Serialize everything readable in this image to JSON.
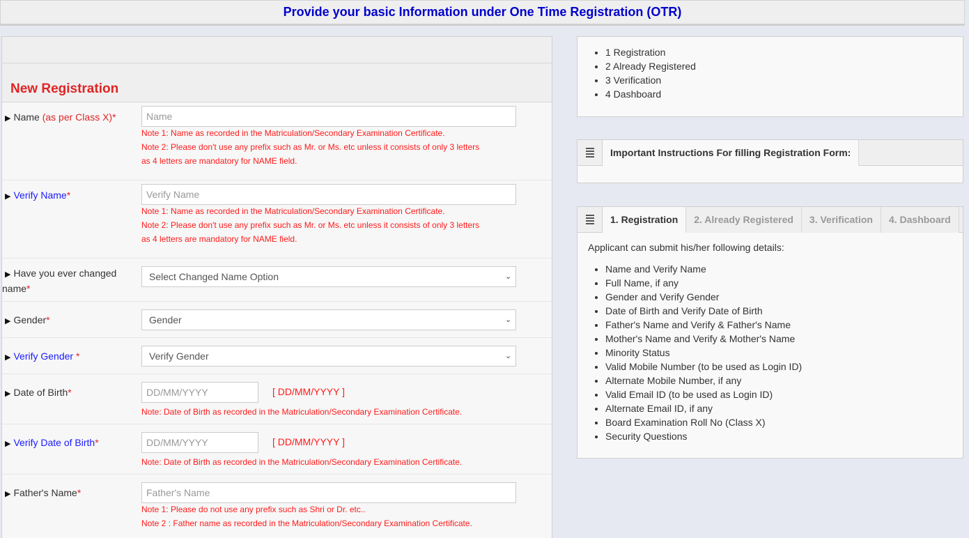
{
  "header": {
    "title": "Provide your basic Information under One Time Registration (OTR)"
  },
  "form": {
    "section_title": "New Registration",
    "fields": {
      "name": {
        "label": "Name",
        "label_suffix": "(as per Class X)",
        "required_mark": "*",
        "placeholder": "Name",
        "notes": [
          "Note 1: Name as recorded in the Matriculation/Secondary Examination Certificate.",
          "Note 2: Please don't use any prefix such as Mr. or Ms. etc unless it consists of only 3 letters",
          "as 4 letters are mandatory for NAME field."
        ]
      },
      "verify_name": {
        "label": "Verify Name",
        "required_mark": "*",
        "placeholder": "Verify Name",
        "notes": [
          "Note 1: Name as recorded in the Matriculation/Secondary Examination Certificate.",
          "Note 2: Please don't use any prefix such as Mr. or Ms. etc unless it consists of only 3 letters",
          "as 4 letters are mandatory for NAME field."
        ]
      },
      "changed_name": {
        "label_line1": "Have you ever changed",
        "label_line2": "name",
        "required_mark": "*",
        "selected": "Select Changed Name Option"
      },
      "gender": {
        "label": "Gender",
        "required_mark": "*",
        "selected": "Gender"
      },
      "verify_gender": {
        "label": "Verify Gender",
        "required_mark": " *",
        "selected": "Verify Gender"
      },
      "dob": {
        "label": "Date of Birth",
        "required_mark": "*",
        "placeholder": "DD/MM/YYYY",
        "format_hint": "[ DD/MM/YYYY ]",
        "note": "Note: Date of Birth as recorded in the Matriculation/Secondary Examination Certificate."
      },
      "verify_dob": {
        "label": "Verify Date of Birth",
        "required_mark": "*",
        "placeholder": "DD/MM/YYYY",
        "format_hint": "[ DD/MM/YYYY ]",
        "note": "Note: Date of Birth as recorded in the Matriculation/Secondary Examination Certificate."
      },
      "father_name": {
        "label": "Father's Name",
        "required_mark": "*",
        "placeholder": "Father's Name",
        "notes": [
          "Note 1: Please do not use any prefix such as Shri or Dr. etc..",
          "Note 2 : Father name as recorded in the Matriculation/Secondary Examination Certificate."
        ]
      }
    }
  },
  "steps": {
    "items": [
      "1 Registration",
      "2 Already Registered",
      "3 Verification",
      "4 Dashboard"
    ]
  },
  "instructions": {
    "tab_label": "Important Instructions For filling Registration Form:"
  },
  "info_panel": {
    "tabs": [
      {
        "label": "1. Registration",
        "active": true
      },
      {
        "label": "2. Already Registered",
        "active": false
      },
      {
        "label": "3. Verification",
        "active": false
      },
      {
        "label": "4. Dashboard",
        "active": false
      }
    ],
    "intro": "Applicant can submit his/her following details:",
    "items": [
      "Name and Verify Name",
      "Full Name, if any",
      "Gender and Verify Gender",
      "Date of Birth and Verify Date of Birth",
      "Father's Name and Verify & Father's Name",
      "Mother's Name and Verify & Mother's Name",
      "Minority Status",
      "Valid Mobile Number (to be used as Login ID)",
      "Alternate Mobile Number, if any",
      "Valid Email ID (to be used as Login ID)",
      "Alternate Email ID, if any",
      "Board Examination Roll No (Class X)",
      "Security Questions"
    ]
  },
  "colors": {
    "title_blue": "#0000cc",
    "heading_red": "#e02424",
    "note_red": "#ff1a1a",
    "verify_label_blue": "#1a1aff",
    "page_bg": "#e6e9f2"
  }
}
